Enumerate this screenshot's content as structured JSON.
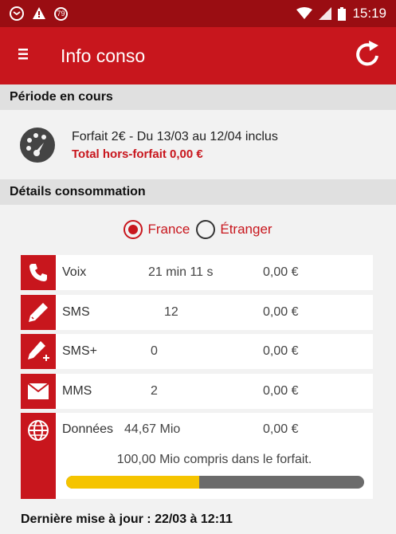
{
  "status_bar": {
    "notification_badge": "79",
    "time": "15:19"
  },
  "app_bar": {
    "title": "Info conso"
  },
  "period_section": {
    "header": "Période en cours",
    "plan_line": "Forfait 2€ - Du 13/03 au 12/04 inclus",
    "extra_line": "Total hors-forfait 0,00 €"
  },
  "details_section": {
    "header": "Détails consommation",
    "radio_options": [
      {
        "label": "France",
        "selected": true
      },
      {
        "label": "Étranger",
        "selected": false
      }
    ],
    "rows": [
      {
        "icon": "phone-icon",
        "label": "Voix",
        "value": "21 min 11 s",
        "price": "0,00 €"
      },
      {
        "icon": "pencil-icon",
        "label": "SMS",
        "value": "12",
        "price": "0,00 €"
      },
      {
        "icon": "pencil-plus-icon",
        "label": "SMS+",
        "value": "0",
        "price": "0,00 €"
      },
      {
        "icon": "envelope-icon",
        "label": "MMS",
        "value": "2",
        "price": "0,00 €"
      }
    ],
    "data_row": {
      "icon": "globe-icon",
      "label": "Données",
      "value": "44,67 Mio",
      "price": "0,00 €",
      "note": "100,00 Mio compris dans le forfait.",
      "usage_fraction": 0.4467
    }
  },
  "footer": {
    "last_update": "Dernière mise à jour : 22/03 à 12:11"
  },
  "colors": {
    "status_bar": "#9a0d12",
    "brand_red": "#c8161d",
    "progress_fill": "#f5c400",
    "progress_track": "#6b6b6b"
  }
}
